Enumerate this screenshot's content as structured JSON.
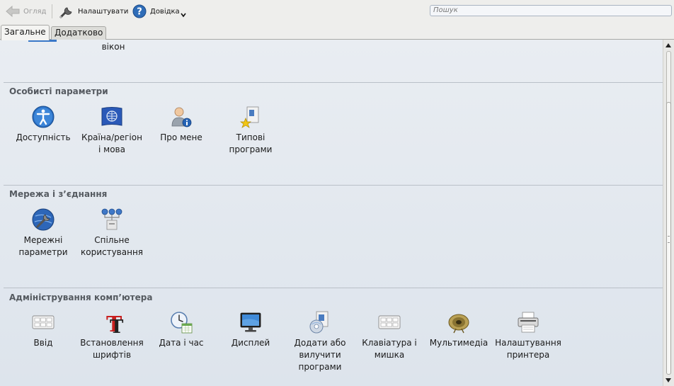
{
  "toolbar": {
    "back_label": "Огляд",
    "configure_label": "Налаштувати",
    "help_label": "Довідка",
    "search_placeholder": "Пошук"
  },
  "tabs": [
    {
      "label": "Загальне",
      "active": true
    },
    {
      "label": "Додатково",
      "active": false
    }
  ],
  "partial_item": {
    "label": "вікон"
  },
  "groups": [
    {
      "title": "Особисті параметри",
      "items": [
        {
          "icon": "accessibility-icon",
          "lines": [
            "Доступність"
          ]
        },
        {
          "icon": "globe-flag-icon",
          "lines": [
            "Країна/регіон",
            "і мова"
          ]
        },
        {
          "icon": "user-info-icon",
          "lines": [
            "Про мене"
          ]
        },
        {
          "icon": "default-apps-icon",
          "lines": [
            "Типові",
            "програми"
          ]
        }
      ]
    },
    {
      "title": "Мережа і з’єднання",
      "items": [
        {
          "icon": "network-settings-icon",
          "lines": [
            "Мережні",
            "параметри"
          ]
        },
        {
          "icon": "sharing-icon",
          "lines": [
            "Спільне",
            "користування"
          ]
        }
      ]
    },
    {
      "title": "Адміністрування комп’ютера",
      "items": [
        {
          "icon": "input-keyboard-icon",
          "lines": [
            "Ввід"
          ]
        },
        {
          "icon": "font-install-icon",
          "lines": [
            "Встановлення",
            "шрифтів"
          ]
        },
        {
          "icon": "date-time-icon",
          "lines": [
            "Дата і час"
          ]
        },
        {
          "icon": "display-icon",
          "lines": [
            "Дисплей"
          ]
        },
        {
          "icon": "add-remove-programs-icon",
          "lines": [
            "Додати або",
            "вилучити",
            "програми"
          ]
        },
        {
          "icon": "keyboard-mouse-icon",
          "lines": [
            "Клавіатура і",
            "мишка"
          ]
        },
        {
          "icon": "multimedia-icon",
          "lines": [
            "Мультимедіа"
          ]
        },
        {
          "icon": "printer-icon",
          "lines": [
            "Налаштування",
            "принтера"
          ]
        }
      ]
    }
  ]
}
